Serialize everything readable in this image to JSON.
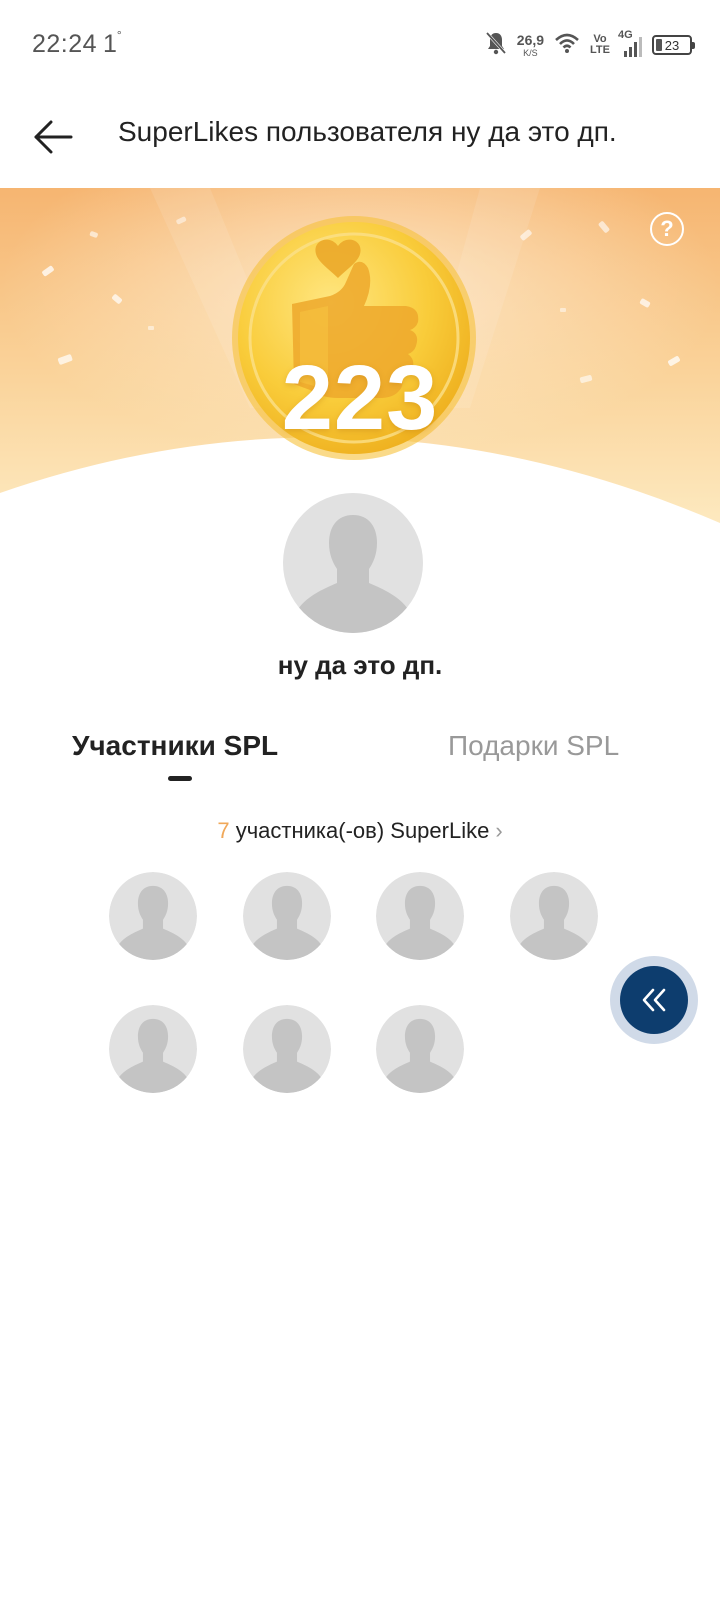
{
  "status_bar": {
    "time": "22:24",
    "extra": "1",
    "net_speed_value": "26,9",
    "net_speed_unit": "K/S",
    "volte_top": "Vo",
    "volte_bottom": "LTE",
    "network": "4G",
    "battery": "23"
  },
  "header": {
    "title": "SuperLikes пользователя ну да это дп."
  },
  "hero": {
    "count": "223",
    "help": "?"
  },
  "user": {
    "name": "ну да это дп."
  },
  "tabs": {
    "participants": "Участники SPL",
    "gifts": "Подарки SPL"
  },
  "participants": {
    "count": "7",
    "label": "участника(-ов) SuperLike",
    "chevron": "›",
    "avatars": [
      "avatar-1",
      "avatar-2",
      "avatar-3",
      "avatar-4",
      "avatar-5",
      "avatar-6",
      "avatar-7"
    ]
  },
  "icons": {
    "back": "arrow-left-icon",
    "help": "question-icon",
    "coin": "thumbs-up-heart-coin-icon",
    "fab": "double-chevron-left-icon"
  },
  "colors": {
    "hero_top": "#f6b571",
    "hero_bottom": "#fde7b8",
    "coin": "#f8c937",
    "accent_number": "#f0a85a",
    "fab": "#0d3d6e"
  }
}
